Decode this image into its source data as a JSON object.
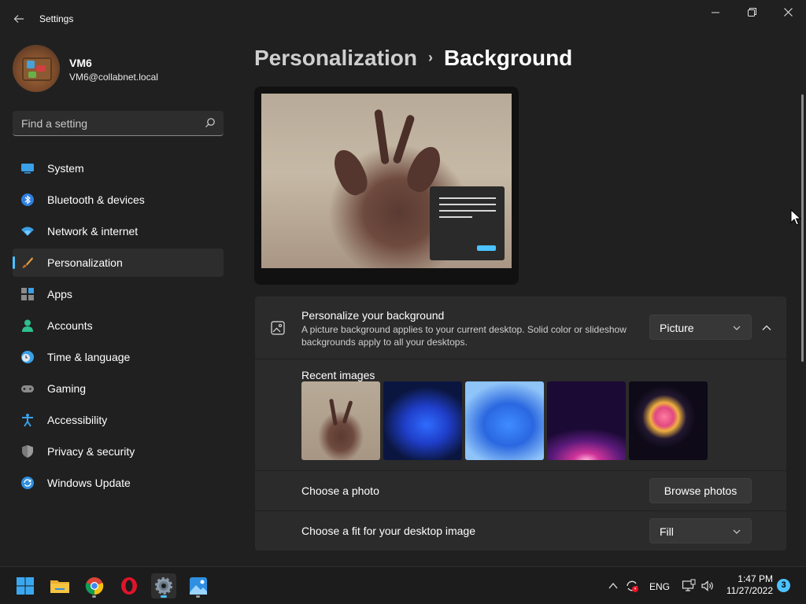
{
  "window": {
    "title": "Settings",
    "back_icon": "back-arrow-icon",
    "minimize_icon": "minimize-icon",
    "maximize_icon": "restore-icon",
    "close_icon": "close-icon"
  },
  "user": {
    "name": "VM6",
    "email": "VM6@collabnet.local"
  },
  "search": {
    "placeholder": "Find a setting",
    "icon": "search-icon"
  },
  "sidebar": {
    "items": [
      {
        "label": "System",
        "icon": "system-icon"
      },
      {
        "label": "Bluetooth & devices",
        "icon": "bluetooth-icon"
      },
      {
        "label": "Network & internet",
        "icon": "wifi-icon"
      },
      {
        "label": "Personalization",
        "icon": "brush-icon",
        "active": true
      },
      {
        "label": "Apps",
        "icon": "apps-icon"
      },
      {
        "label": "Accounts",
        "icon": "person-icon"
      },
      {
        "label": "Time & language",
        "icon": "clock-globe-icon"
      },
      {
        "label": "Gaming",
        "icon": "gamepad-icon"
      },
      {
        "label": "Accessibility",
        "icon": "accessibility-icon"
      },
      {
        "label": "Privacy & security",
        "icon": "shield-icon"
      },
      {
        "label": "Windows Update",
        "icon": "update-icon"
      }
    ]
  },
  "breadcrumb": {
    "parent": "Personalization",
    "separator": "›",
    "current": "Background"
  },
  "background": {
    "title": "Personalize your background",
    "description": "A picture background applies to your current desktop. Solid color or slideshow backgrounds apply to all your desktops.",
    "type_value": "Picture",
    "recent_label": "Recent images",
    "recent_images": [
      "deer-photo",
      "blue-bloom-dark",
      "blue-bloom-light",
      "purple-glow",
      "colorful-flower"
    ],
    "choose_photo_label": "Choose a photo",
    "browse_label": "Browse photos",
    "fit_label": "Choose a fit for your desktop image",
    "fit_value": "Fill"
  },
  "taskbar": {
    "apps": [
      "start-icon",
      "file-explorer-icon",
      "chrome-icon",
      "opera-icon",
      "settings-icon",
      "photos-icon"
    ],
    "language": "ENG",
    "time": "1:47 PM",
    "date": "11/27/2022",
    "notification_count": "3"
  },
  "colors": {
    "accent": "#4cc2ff",
    "background": "#202020",
    "card": "#2b2b2b"
  }
}
